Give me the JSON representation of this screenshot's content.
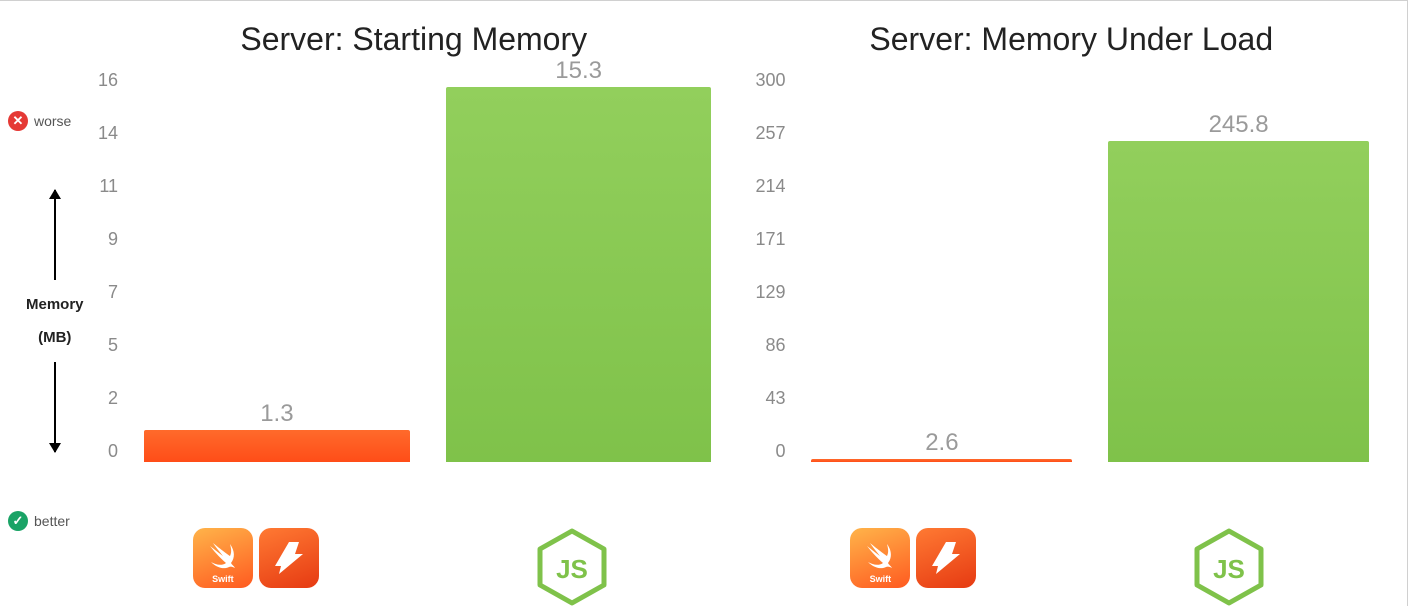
{
  "legend": {
    "worse": "worse",
    "better": "better",
    "axis_label_1": "Memory",
    "axis_label_2": "(MB)"
  },
  "icons": {
    "swift_sub": "Swift",
    "node_text": "JS"
  },
  "chart_data": [
    {
      "type": "bar",
      "title": "Server: Starting Memory",
      "ylabel": "Memory (MB)",
      "ylim": [
        0,
        16
      ],
      "y_ticks": [
        16,
        14,
        11,
        9,
        7,
        5,
        2,
        0
      ],
      "categories": [
        "Swift/Kitura",
        "Node.js"
      ],
      "values": [
        1.3,
        15.3
      ]
    },
    {
      "type": "bar",
      "title": "Server: Memory Under Load",
      "ylabel": "Memory (MB)",
      "ylim": [
        0,
        300
      ],
      "y_ticks": [
        300,
        257,
        214,
        171,
        129,
        86,
        43,
        0
      ],
      "categories": [
        "Swift/Kitura",
        "Node.js"
      ],
      "values": [
        2.6,
        245.8
      ]
    }
  ]
}
